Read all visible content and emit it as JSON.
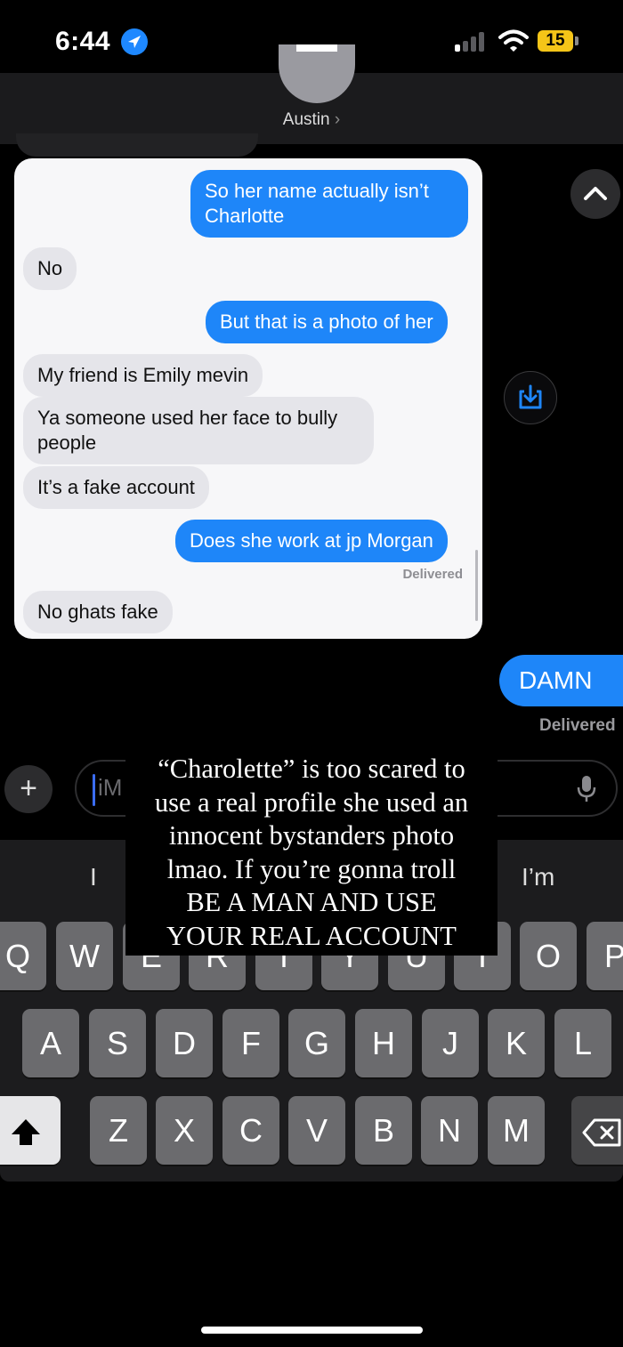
{
  "status_bar": {
    "time": "6:44",
    "battery": "15",
    "location_icon": "location-arrow-icon",
    "signal_icon": "cellular-signal-icon",
    "wifi_icon": "wifi-icon",
    "battery_icon": "battery-icon"
  },
  "header": {
    "contact_name": "Austin",
    "chevron": "›",
    "avatar_icon": "contact-avatar"
  },
  "screenshot": {
    "messages": [
      {
        "dir": "out",
        "text": "So her name actually isn’t Charlotte"
      },
      {
        "dir": "in",
        "text": "No"
      },
      {
        "dir": "out",
        "text": "But that is a photo of her"
      },
      {
        "dir": "in",
        "text": "My friend is Emily mevin"
      },
      {
        "dir": "in",
        "text": "Ya someone used her face to bully people"
      },
      {
        "dir": "in",
        "text": "It’s a fake account"
      },
      {
        "dir": "out",
        "text": "Does she work at jp Morgan"
      },
      {
        "dir": "in",
        "text": "No ghats fake"
      }
    ],
    "delivered": "Delivered"
  },
  "thread": {
    "last_message": "DAMN",
    "delivered": "Delivered"
  },
  "input": {
    "placeholder": "iM",
    "plus_label": "+",
    "mic_icon": "microphone-icon"
  },
  "keyboard": {
    "suggestions": [
      "I",
      "I’m"
    ],
    "row1": [
      "Q",
      "W",
      "E",
      "R",
      "T",
      "Y",
      "U",
      "I",
      "O",
      "P"
    ],
    "row2": [
      "A",
      "S",
      "D",
      "F",
      "G",
      "H",
      "J",
      "K",
      "L"
    ],
    "row3": [
      "Z",
      "X",
      "C",
      "V",
      "B",
      "N",
      "M"
    ],
    "shift_icon": "shift-icon",
    "delete_icon": "delete-icon"
  },
  "caption": {
    "lines": [
      "“Charolette” is too scared to",
      "use a real profile she used an",
      "innocent bystanders photo",
      "lmao. If you’re gonna troll",
      "BE A MAN AND USE",
      "YOUR REAL ACCOUNT"
    ]
  },
  "colors": {
    "imessage_blue": "#1e86f9",
    "received_gray": "#e5e5ea",
    "background": "#000000",
    "battery_yellow": "#f5c518"
  }
}
